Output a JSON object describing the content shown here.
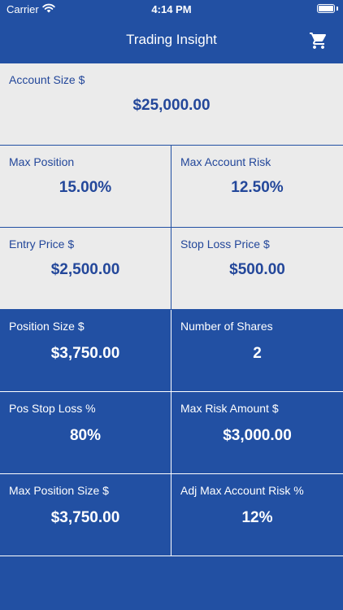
{
  "status_bar": {
    "carrier": "Carrier",
    "time": "4:14 PM",
    "battery_level": 1.0
  },
  "nav": {
    "title": "Trading Insight",
    "cart_icon": "shopping-cart-icon"
  },
  "account": {
    "label": "Account Size $",
    "value": "$25,000.00"
  },
  "inputs": {
    "max_position": {
      "label": "Max Position",
      "value": "15.00%"
    },
    "max_account_risk": {
      "label": "Max Account Risk",
      "value": "12.50%"
    },
    "entry_price": {
      "label": "Entry Price $",
      "value": "$2,500.00"
    },
    "stop_loss_price": {
      "label": "Stop Loss Price $",
      "value": "$500.00"
    }
  },
  "results": {
    "position_size": {
      "label": "Position Size $",
      "value": "$3,750.00"
    },
    "number_of_shares": {
      "label": "Number of Shares",
      "value": "2"
    },
    "pos_stop_loss": {
      "label": "Pos Stop Loss %",
      "value": "80%"
    },
    "max_risk_amount": {
      "label": "Max Risk Amount $",
      "value": "$3,000.00"
    },
    "max_position_size": {
      "label": "Max Position Size $",
      "value": "$3,750.00"
    },
    "adj_max_account_risk": {
      "label": "Adj Max Account Risk %",
      "value": "12%"
    }
  },
  "colors": {
    "primary": "#2250a3",
    "light_cell": "#ebebeb",
    "light_text": "#23479a",
    "dark_text": "#ffffff"
  }
}
